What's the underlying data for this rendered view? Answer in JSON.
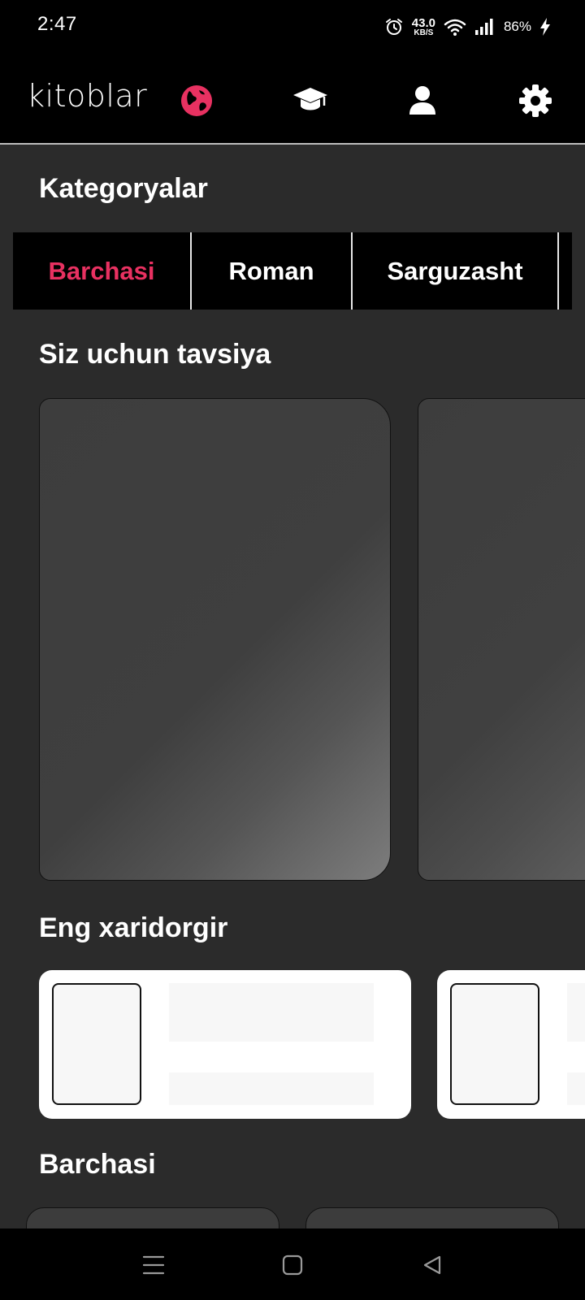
{
  "status_bar": {
    "time": "2:47",
    "net_speed_value": "43.0",
    "net_speed_unit": "KB/S",
    "battery": "86%"
  },
  "app_bar": {
    "title": "kitoblar",
    "nav_icons": [
      "globe-icon",
      "graduation-cap-icon",
      "user-icon",
      "gear-icon"
    ],
    "active_color": "#e83161"
  },
  "sections": {
    "categories_title": "Kategoryalar",
    "recommend_title": "Siz uchun tavsiya",
    "bestseller_title": "Eng xaridorgir",
    "all_title": "Barchasi"
  },
  "categories": [
    {
      "label": "Barchasi",
      "active": true
    },
    {
      "label": "Roman",
      "active": false
    },
    {
      "label": "Sarguzasht",
      "active": false
    }
  ],
  "system_nav": [
    "menu-icon",
    "home-icon",
    "back-icon"
  ]
}
